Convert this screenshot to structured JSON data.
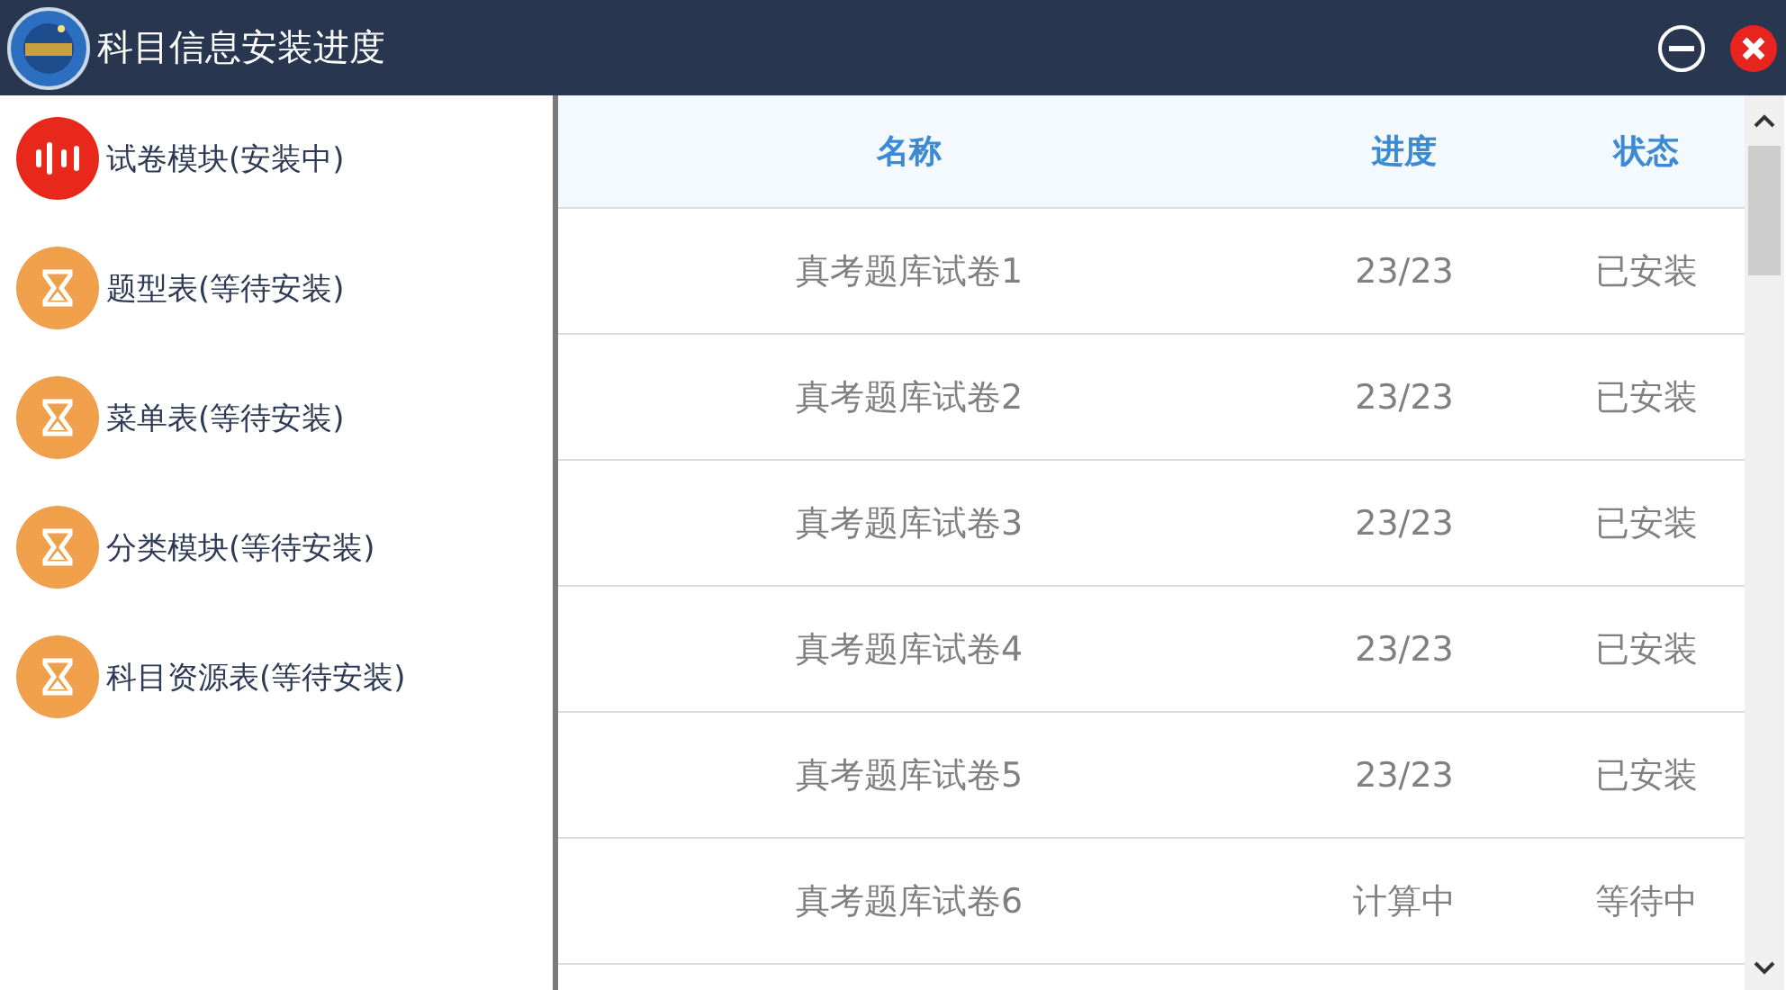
{
  "window": {
    "title": "科目信息安装进度"
  },
  "modules": [
    {
      "label": "试卷模块(安装中)",
      "kind": "installing"
    },
    {
      "label": "题型表(等待安装)",
      "kind": "waiting"
    },
    {
      "label": "菜单表(等待安装)",
      "kind": "waiting"
    },
    {
      "label": "分类模块(等待安装)",
      "kind": "waiting"
    },
    {
      "label": "科目资源表(等待安装)",
      "kind": "waiting"
    }
  ],
  "table": {
    "columns": [
      "名称",
      "进度",
      "状态"
    ],
    "rows": [
      [
        "真考题库试卷1",
        "23/23",
        "已安装"
      ],
      [
        "真考题库试卷2",
        "23/23",
        "已安装"
      ],
      [
        "真考题库试卷3",
        "23/23",
        "已安装"
      ],
      [
        "真考题库试卷4",
        "23/23",
        "已安装"
      ],
      [
        "真考题库试卷5",
        "23/23",
        "已安装"
      ],
      [
        "真考题库试卷6",
        "计算中",
        "等待中"
      ]
    ]
  }
}
